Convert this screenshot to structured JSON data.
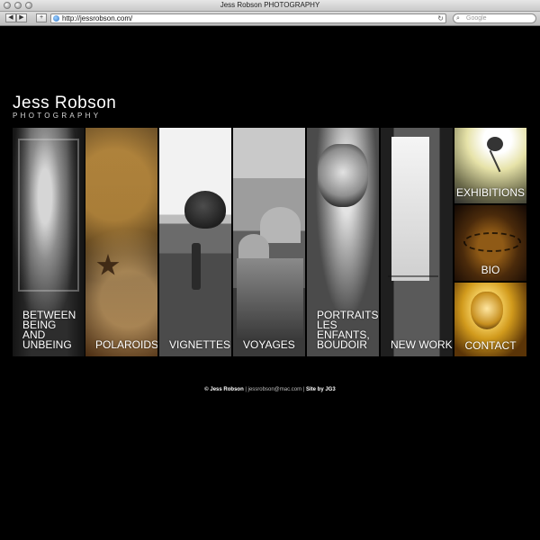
{
  "window": {
    "title": "Jess Robson PHOTOGRAPHY"
  },
  "toolbar": {
    "back_icon": "back-arrow-icon",
    "forward_icon": "forward-arrow-icon",
    "add_icon": "plus-icon",
    "url": "http://jessrobson.com/",
    "search_placeholder": "Google"
  },
  "site": {
    "logo_name": "Jess Robson",
    "logo_sub": "PHOTOGRAPHY"
  },
  "gallery": {
    "panels": [
      {
        "label": "BETWEEN\nBEING\nAND\nUNBEING"
      },
      {
        "label": "POLAROIDS"
      },
      {
        "label": "VIGNETTES"
      },
      {
        "label": "VOYAGES"
      },
      {
        "label": "PORTRAITS,\nLES ENFANTS,\nBOUDOIR"
      },
      {
        "label": "NEW WORK"
      }
    ],
    "side": [
      {
        "label": "EXHIBITIONS"
      },
      {
        "label": "BIO"
      },
      {
        "label": "CONTACT"
      }
    ]
  },
  "footer": {
    "copyright": "© Jess Robson",
    "email": "jessrobson@mac.com",
    "credit": "Site by JG3"
  }
}
